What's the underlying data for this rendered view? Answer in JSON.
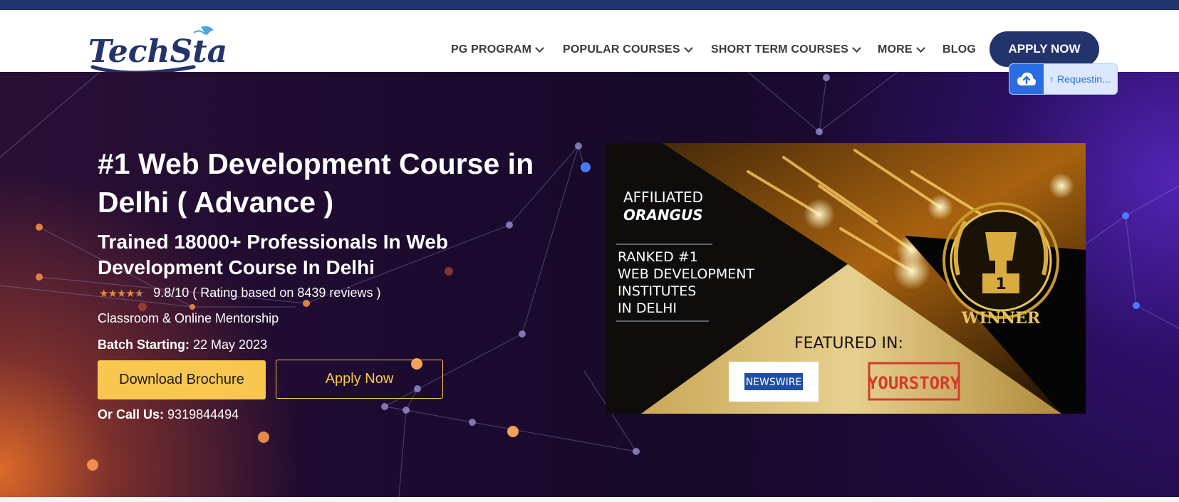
{
  "brand": {
    "logo_text": "TechStack"
  },
  "nav": {
    "items": [
      {
        "label": "PG PROGRAM",
        "has_dropdown": true
      },
      {
        "label": "POPULAR COURSES",
        "has_dropdown": true
      },
      {
        "label": "SHORT TERM COURSES",
        "has_dropdown": true
      },
      {
        "label": "MORE",
        "has_dropdown": true
      },
      {
        "label": "BLOG",
        "has_dropdown": false
      }
    ],
    "cta_label": "APPLY NOW"
  },
  "upload_widget": {
    "status": "Requestin..."
  },
  "hero": {
    "title": "#1 Web Development Course in Delhi ( Advance )",
    "subtitle": "Trained 18000+ Professionals In Web Development Course In Delhi",
    "rating_text": "9.8/10 ( Rating based on 8439 reviews )",
    "stars": 4.5,
    "mentorship": "Classroom & Online Mentorship",
    "batch_label": "Batch Starting:",
    "batch_date": "22 May 2023",
    "brochure_label": "Download Brochure",
    "apply_label": "Apply Now",
    "call_label": "Or Call Us:",
    "call_number": "9319844494"
  },
  "banner": {
    "affiliated": "AFFILIATED",
    "affiliated_brand": "ORANGUS",
    "ranked_lines": [
      "RANKED #1",
      "WEB DEVELOPMENT",
      "INSTITUTES",
      "IN DELHI"
    ],
    "featured": "FEATURED IN:",
    "newswire": "NEWSWIRE",
    "yourstory": "YOURSTORY",
    "trophy_number": "1",
    "winner": "WINNER"
  },
  "colors": {
    "navy": "#23336b",
    "accent_yellow": "#f9c74f",
    "upload_blue": "#2a6de0"
  }
}
